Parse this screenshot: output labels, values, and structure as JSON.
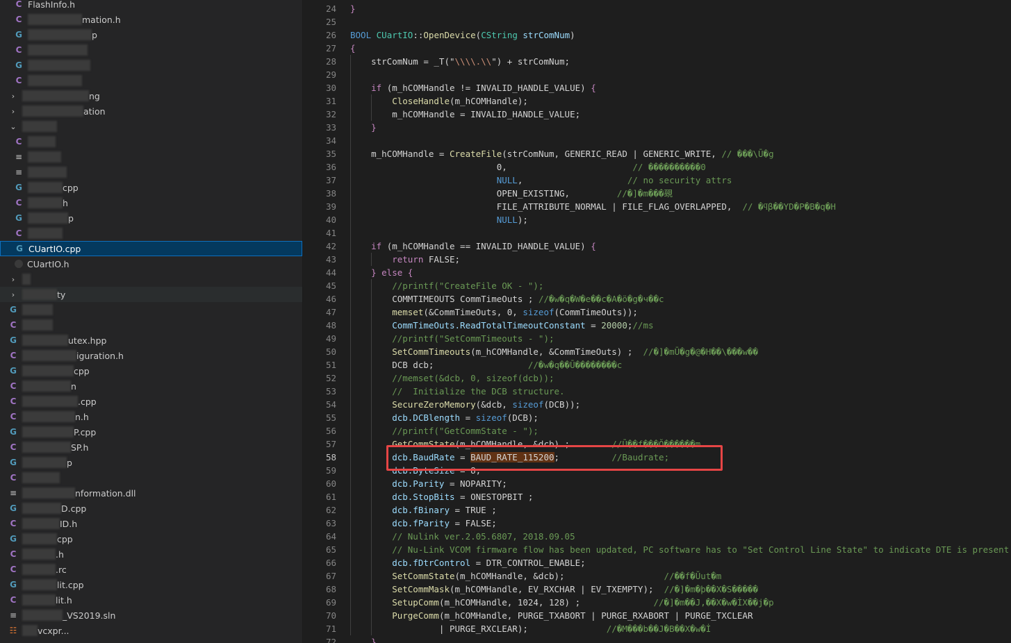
{
  "sidebar": {
    "items": [
      {
        "icon": "c",
        "text": "FlashInfo.h",
        "pre": 0
      },
      {
        "icon": "c",
        "text": "mation.h",
        "pre": 78
      },
      {
        "icon": "cpp",
        "text": "p",
        "pre": 92
      },
      {
        "icon": "c",
        "text": "",
        "pre": 86
      },
      {
        "icon": "cpp",
        "text": "",
        "pre": 90
      },
      {
        "icon": "c",
        "text": "",
        "pre": 78
      },
      {
        "icon": "chevron-right",
        "text": "ng",
        "pre": 96
      },
      {
        "icon": "chevron-right",
        "text": "ation",
        "pre": 88
      },
      {
        "icon": "chevron-down",
        "text": "",
        "pre": 50
      },
      {
        "icon": "c",
        "text": "",
        "pre": 40
      },
      {
        "icon": "txt",
        "text": "",
        "pre": 48
      },
      {
        "icon": "txt",
        "text": "",
        "pre": 56
      },
      {
        "icon": "cpp",
        "text": "cpp",
        "pre": 50
      },
      {
        "icon": "c",
        "text": "h",
        "pre": 50
      },
      {
        "icon": "cpp",
        "text": "p",
        "pre": 58
      },
      {
        "icon": "c",
        "text": "",
        "pre": 50
      },
      {
        "icon": "cpp",
        "text": "CUartIO.cpp",
        "pre": 0
      },
      {
        "icon": "dot",
        "text": "CUartIO.h",
        "pre": 0
      },
      {
        "icon": "chevron-right",
        "text": "",
        "pre": 12
      },
      {
        "icon": "chevron-right",
        "text": "ty",
        "pre": 50
      },
      {
        "icon": "cpp",
        "text": "",
        "pre": 44
      },
      {
        "icon": "c",
        "text": "",
        "pre": 44
      },
      {
        "icon": "cpp",
        "text": "utex.hpp",
        "pre": 66
      },
      {
        "icon": "c",
        "text": "iguration.h",
        "pre": 78
      },
      {
        "icon": "cpp",
        "text": "cpp",
        "pre": 74
      },
      {
        "icon": "c",
        "text": "n",
        "pre": 70
      },
      {
        "icon": "c",
        "text": ".cpp",
        "pre": 80
      },
      {
        "icon": "c",
        "text": "n.h",
        "pre": 76
      },
      {
        "icon": "cpp",
        "text": "P.cpp",
        "pre": 74
      },
      {
        "icon": "c",
        "text": "SP.h",
        "pre": 70
      },
      {
        "icon": "cpp",
        "text": "p",
        "pre": 64
      },
      {
        "icon": "c",
        "text": "",
        "pre": 54
      },
      {
        "icon": "txt",
        "text": "nformation.dll",
        "pre": 76
      },
      {
        "icon": "cpp",
        "text": "D.cpp",
        "pre": 56
      },
      {
        "icon": "c",
        "text": "ID.h",
        "pre": 54
      },
      {
        "icon": "cpp",
        "text": "cpp",
        "pre": 50
      },
      {
        "icon": "c",
        "text": ".h",
        "pre": 48
      },
      {
        "icon": "c",
        "text": ".rc",
        "pre": 48
      },
      {
        "icon": "cpp",
        "text": "lit.cpp",
        "pre": 50
      },
      {
        "icon": "c",
        "text": "lit.h",
        "pre": 48
      },
      {
        "icon": "txt",
        "text": "_VS2019.sln",
        "pre": 58
      },
      {
        "icon": "rss",
        "text": "vcxpr...",
        "pre": 22
      }
    ]
  },
  "editor": {
    "line_numbers": [
      "24",
      "25",
      "26",
      "27",
      "28",
      "29",
      "30",
      "31",
      "32",
      "33",
      "34",
      "35",
      "36",
      "37",
      "38",
      "39",
      "40",
      "41",
      "42",
      "43",
      "44",
      "45",
      "46",
      "47",
      "48",
      "49",
      "50",
      "51",
      "52",
      "53",
      "54",
      "55",
      "56",
      "57",
      "58",
      "59",
      "60",
      "61",
      "62",
      "63",
      "64",
      "65",
      "66",
      "67",
      "68",
      "69",
      "70",
      "71",
      "72"
    ],
    "active_line": "58",
    "lines": [
      [
        [
          "ctl",
          "}"
        ]
      ],
      [],
      [
        [
          "kw",
          "BOOL "
        ],
        [
          "ty",
          "CUartIO"
        ],
        [
          "plain",
          "::"
        ],
        [
          "fn",
          "OpenDevice"
        ],
        [
          "plain",
          "("
        ],
        [
          "ty",
          "CString"
        ],
        [
          "var",
          " strComNum"
        ],
        [
          "plain",
          ")"
        ]
      ],
      [
        [
          "ctl",
          "{"
        ]
      ],
      [
        [
          "plain",
          "    strComNum = _T(\""
        ],
        [
          "str",
          "\\\\\\\\.\\\\"
        ],
        [
          "plain",
          "\") + strComNum;"
        ]
      ],
      [],
      [
        [
          "ctl",
          "    if "
        ],
        [
          "plain",
          "(m_hCOMHandle != INVALID_HANDLE_VALUE) "
        ],
        [
          "ctl",
          "{"
        ]
      ],
      [
        [
          "fn",
          "        CloseHandle"
        ],
        [
          "plain",
          "(m_hCOMHandle);"
        ]
      ],
      [
        [
          "plain",
          "        m_hCOMHandle = INVALID_HANDLE_VALUE;"
        ]
      ],
      [
        [
          "ctl",
          "    }"
        ]
      ],
      [],
      [
        [
          "plain",
          "    m_hCOMHandle = "
        ],
        [
          "fn",
          "CreateFile"
        ],
        [
          "plain",
          "(strComNum, GENERIC_READ | GENERIC_WRITE, "
        ],
        [
          "cm",
          "// ���\\Ū�g"
        ]
      ],
      [
        [
          "plain",
          "                            0,                        "
        ],
        [
          "cm",
          "// ����������0"
        ]
      ],
      [
        [
          "kw",
          "                            NULL"
        ],
        [
          "plain",
          ",                    "
        ],
        [
          "cm",
          "// no security attrs"
        ]
      ],
      [
        [
          "plain",
          "                            OPEN_EXISTING,         "
        ],
        [
          "cm",
          "//�]�m���覡"
        ]
      ],
      [
        [
          "plain",
          "                            FILE_ATTRIBUTE_NORMAL | FILE_FLAG_OVERLAPPED,  "
        ],
        [
          "cm",
          "// �ϥβ��YD�P�B�q�H"
        ]
      ],
      [
        [
          "kw",
          "                            NULL"
        ],
        [
          "plain",
          ");"
        ]
      ],
      [],
      [
        [
          "ctl",
          "    if "
        ],
        [
          "plain",
          "(m_hCOMHandle == INVALID_HANDLE_VALUE) "
        ],
        [
          "ctl",
          "{"
        ]
      ],
      [
        [
          "ctl",
          "        return "
        ],
        [
          "plain",
          "FALSE;"
        ]
      ],
      [
        [
          "ctl",
          "    } else {"
        ]
      ],
      [
        [
          "cm",
          "        //printf(\"CreateFile OK - \");"
        ]
      ],
      [
        [
          "plain",
          "        COMMTIMEOUTS CommTimeOuts ; "
        ],
        [
          "cm",
          "//�w�q�W�e��c�A�ö�g�ч��c"
        ]
      ],
      [
        [
          "fn",
          "        memset"
        ],
        [
          "plain",
          "(&CommTimeOuts, 0, "
        ],
        [
          "kw",
          "sizeof"
        ],
        [
          "plain",
          "(CommTimeOuts));"
        ]
      ],
      [
        [
          "var",
          "        CommTimeOuts.ReadTotalTimeoutConstant"
        ],
        [
          "plain",
          " = "
        ],
        [
          "num",
          "20000"
        ],
        [
          "plain",
          ";"
        ],
        [
          "cm",
          "//ms"
        ]
      ],
      [
        [
          "cm",
          "        //printf(\"SetCommTimeouts - \");"
        ]
      ],
      [
        [
          "fn",
          "        SetCommTimeouts"
        ],
        [
          "plain",
          "(m_hCOMHandle, &CommTimeOuts) ;  "
        ],
        [
          "cm",
          "//�]�mŪ�g�@�H��\\���w��"
        ]
      ],
      [
        [
          "plain",
          "        DCB dcb;                  "
        ],
        [
          "cm",
          "//�w�q��Ū��������c"
        ]
      ],
      [
        [
          "cm",
          "        //memset(&dcb, 0, sizeof(dcb));"
        ]
      ],
      [
        [
          "cm",
          "        //  Initialize the DCB structure."
        ]
      ],
      [
        [
          "fn",
          "        SecureZeroMemory"
        ],
        [
          "plain",
          "(&dcb, "
        ],
        [
          "kw",
          "sizeof"
        ],
        [
          "plain",
          "(DCB));"
        ]
      ],
      [
        [
          "var",
          "        dcb.DCBlength"
        ],
        [
          "plain",
          " = "
        ],
        [
          "kw",
          "sizeof"
        ],
        [
          "plain",
          "(DCB);"
        ]
      ],
      [
        [
          "cm",
          "        //printf(\"GetCommState - \");"
        ]
      ],
      [
        [
          "fn",
          "        GetCommState"
        ],
        [
          "plain",
          "(m_hCOMHandle, &dcb) ;        "
        ],
        [
          "cm",
          "//Ū��f���Ŏ������m"
        ]
      ],
      [
        [
          "var",
          "        dcb.BaudRate"
        ],
        [
          "plain",
          " = "
        ],
        [
          "hl",
          "BAUD_RATE_115200"
        ],
        [
          "plain",
          ";          "
        ],
        [
          "cm",
          "//Baudrate;"
        ]
      ],
      [
        [
          "var",
          "        dcb.ByteSize"
        ],
        [
          "plain",
          " = 8;"
        ]
      ],
      [
        [
          "var",
          "        dcb.Parity"
        ],
        [
          "plain",
          " = NOPARITY;"
        ]
      ],
      [
        [
          "var",
          "        dcb.StopBits"
        ],
        [
          "plain",
          " = ONESTOPBIT ;"
        ]
      ],
      [
        [
          "var",
          "        dcb.fBinary"
        ],
        [
          "plain",
          " = TRUE ;"
        ]
      ],
      [
        [
          "var",
          "        dcb.fParity"
        ],
        [
          "plain",
          " = FALSE;"
        ]
      ],
      [
        [
          "cm",
          "        // Nulink ver.2.05.6807, 2018.09.05"
        ]
      ],
      [
        [
          "cm",
          "        // Nu-Link VCOM firmware flow has been updated, PC software has to \"Set Control Line State\" to indicate DTE is present"
        ]
      ],
      [
        [
          "var",
          "        dcb.fDtrControl"
        ],
        [
          "plain",
          " = DTR_CONTROL_ENABLE;"
        ]
      ],
      [
        [
          "fn",
          "        SetCommState"
        ],
        [
          "plain",
          "(m_hCOMHandle, &dcb);                   "
        ],
        [
          "cm",
          "//��f�Ŭut�m"
        ]
      ],
      [
        [
          "fn",
          "        SetCommMask"
        ],
        [
          "plain",
          "(m_hCOMHandle, EV_RXCHAR | EV_TXEMPTY);  "
        ],
        [
          "cm",
          "//�]�m�þ��X�Ѕ�����"
        ]
      ],
      [
        [
          "fn",
          "        SetupComm"
        ],
        [
          "plain",
          "(m_hCOMHandle, 1024, 128) ;              "
        ],
        [
          "cm",
          "//�]�m��J,��X�w�İX��j�p"
        ]
      ],
      [
        [
          "fn",
          "        PurgeComm"
        ],
        [
          "plain",
          "(m_hCOMHandle, PURGE_TXABORT | PURGE_RXABORT | PURGE_TXCLEAR"
        ]
      ],
      [
        [
          "plain",
          "                 | PURGE_RXCLEAR);               "
        ],
        [
          "cm",
          "//�M���b��J�B��X�w�İ"
        ]
      ],
      [
        [
          "ctl",
          "    }"
        ]
      ]
    ]
  }
}
